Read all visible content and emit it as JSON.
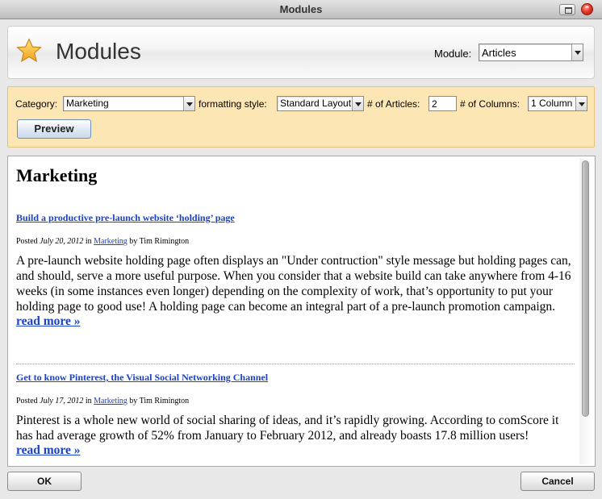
{
  "window": {
    "title": "Modules"
  },
  "header": {
    "title": "Modules",
    "module_label": "Module:",
    "module_value": "Articles"
  },
  "options": {
    "category_label": "Category:",
    "category_value": "Marketing",
    "style_label": "formatting style:",
    "style_value": "Standard Layout",
    "articles_label": "# of Articles:",
    "articles_value": "2",
    "columns_label": "# of Columns:",
    "columns_value": "1 Column",
    "preview_label": "Preview"
  },
  "content": {
    "heading": "Marketing",
    "articles": [
      {
        "title": "Build a productive pre-launch website ‘holding’ page",
        "posted": "Posted",
        "date": "July 20, 2012",
        "in": "in",
        "category": "Marketing",
        "author": "by Tim Rimington",
        "body": "A pre-launch website holding page often displays an \"Under contruction\" style message but holding pages can, and should, serve a more useful purpose. When you consider that a website build can take anywhere from 4-16 weeks (in some instances even longer) depending on the complexity of work, that’s opportunity to put your holding page to good use! A holding page can become an integral part of a pre-launch promotion campaign.",
        "more": "read more »"
      },
      {
        "title": "Get to know Pinterest, the Visual Social Networking Channel",
        "posted": "Posted",
        "date": "July 17, 2012",
        "in": "in",
        "category": "Marketing",
        "author": "by Tim Rimington",
        "body": "Pinterest is a whole new world of social sharing of ideas, and it’s rapidly growing. According to comScore it has had average growth of 52% from January to February 2012, and already boasts 17.8 million users!",
        "more": "read more »"
      }
    ]
  },
  "footer": {
    "ok_label": "OK",
    "cancel_label": "Cancel"
  },
  "colors": {
    "options_bg": "#fce6b4",
    "link": "#1a42c2"
  }
}
